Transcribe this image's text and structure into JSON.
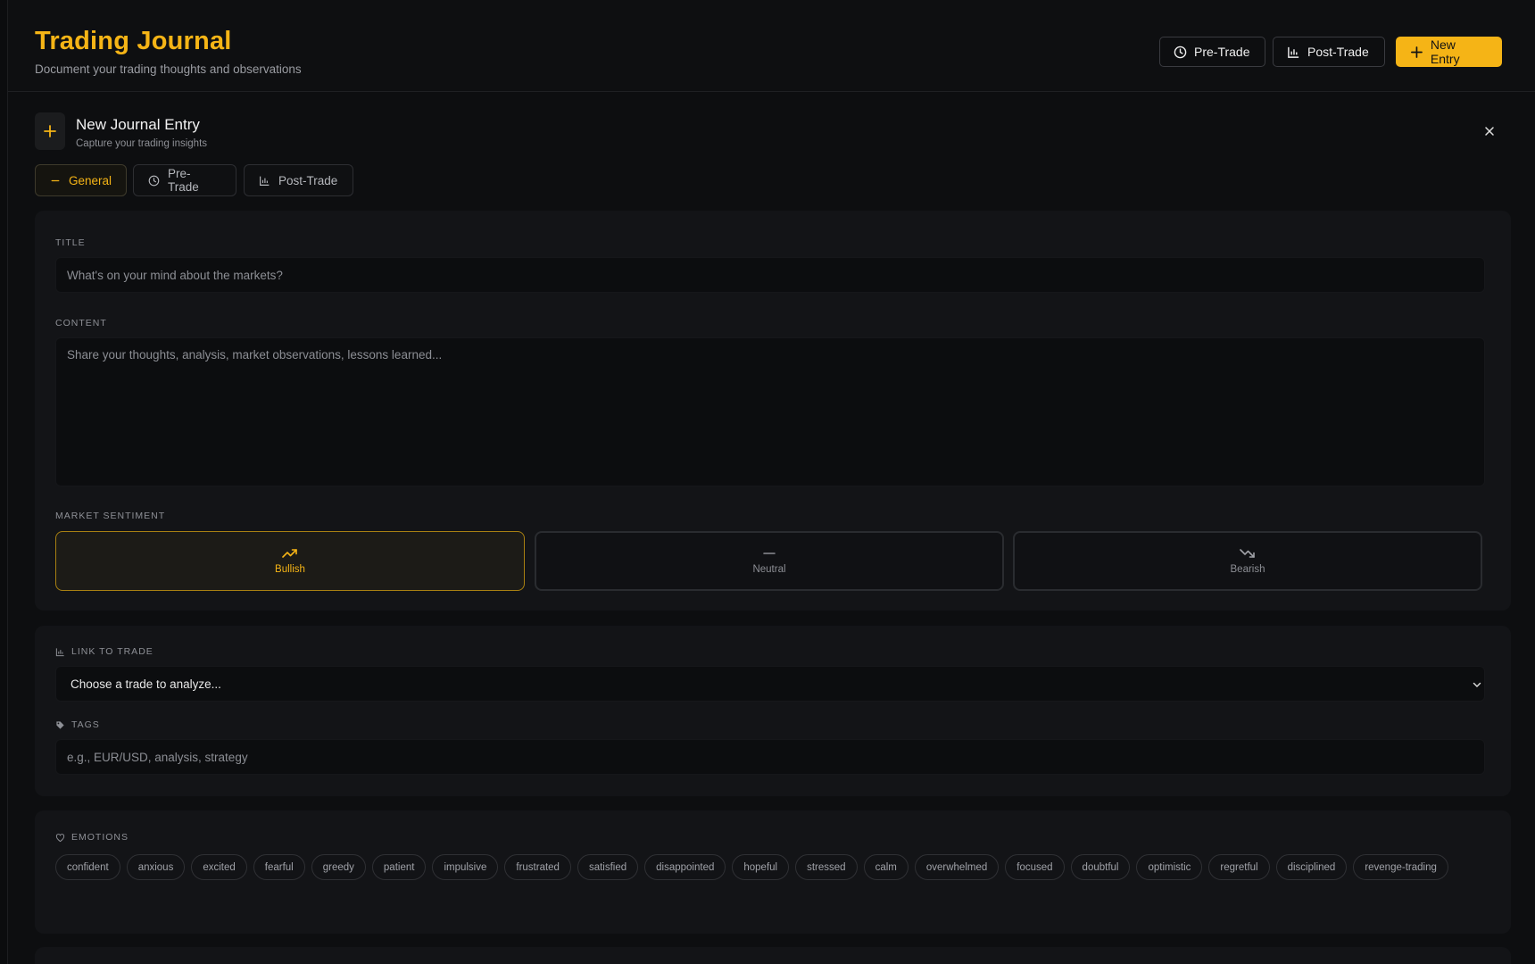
{
  "header": {
    "title": "Trading Journal",
    "subtitle": "Document your trading thoughts and observations",
    "buttons": {
      "pre_trade": "Pre-Trade",
      "post_trade": "Post-Trade",
      "new_entry": "New Entry"
    }
  },
  "entry": {
    "title": "New Journal Entry",
    "subtitle": "Capture your trading insights"
  },
  "tabs": [
    {
      "label": "General",
      "active": true
    },
    {
      "label": "Pre-Trade",
      "active": false
    },
    {
      "label": "Post-Trade",
      "active": false
    }
  ],
  "form": {
    "title_label": "TITLE",
    "title_placeholder": "What's on your mind about the markets?",
    "content_label": "CONTENT",
    "content_placeholder": "Share your thoughts, analysis, market observations, lessons learned...",
    "sentiment_label": "MARKET SENTIMENT",
    "sentiments": [
      {
        "label": "Bullish",
        "selected": true
      },
      {
        "label": "Neutral",
        "selected": false
      },
      {
        "label": "Bearish",
        "selected": false
      }
    ],
    "link_label": "LINK TO TRADE",
    "link_selected": "Choose a trade to analyze...",
    "tags_label": "TAGS",
    "tags_placeholder": "e.g., EUR/USD, analysis, strategy",
    "emotions_label": "EMOTIONS",
    "emotions": [
      "confident",
      "anxious",
      "excited",
      "fearful",
      "greedy",
      "patient",
      "impulsive",
      "frustrated",
      "satisfied",
      "disappointed",
      "hopeful",
      "stressed",
      "calm",
      "overwhelmed",
      "focused",
      "doubtful",
      "optimistic",
      "regretful",
      "disciplined",
      "revenge-trading"
    ]
  },
  "colors": {
    "accent": "#f5b416",
    "background": "#0d0e10",
    "panel": "#131417"
  }
}
